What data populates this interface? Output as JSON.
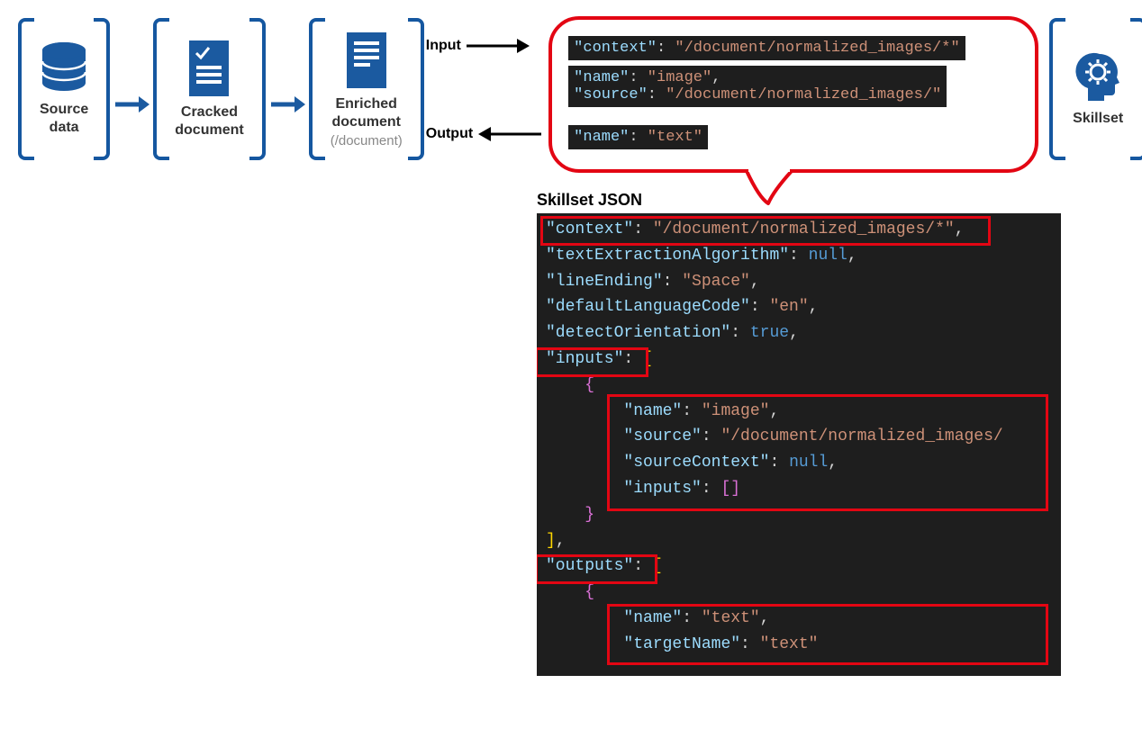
{
  "stages": {
    "source": {
      "label": "Source\ndata"
    },
    "cracked": {
      "label": "Cracked\ndocument"
    },
    "enriched": {
      "label": "Enriched\ndocument",
      "sublabel": "(/document)"
    },
    "skillset": {
      "label": "Skillset"
    }
  },
  "io": {
    "input": "Input",
    "output": "Output"
  },
  "bubble": {
    "context_key": "\"context\"",
    "context_val": "\"/document/normalized_images/*\"",
    "name_key": "\"name\"",
    "name_val_image": "\"image\"",
    "source_key": "\"source\"",
    "source_val": "\"/document/normalized_images/\"",
    "name_val_text": "\"text\""
  },
  "jsonPanel": {
    "title": "Skillset JSON",
    "lines": {
      "l1a": "\"context\"",
      "l1b": "\"/document/normalized_images/*\"",
      "l2a": "\"textExtractionAlgorithm\"",
      "l2b": "null",
      "l3a": "\"lineEnding\"",
      "l3b": "\"Space\"",
      "l4a": "\"defaultLanguageCode\"",
      "l4b": "\"en\"",
      "l5a": "\"detectOrientation\"",
      "l5b": "true",
      "l6a": "\"inputs\"",
      "l8a": "\"name\"",
      "l8b": "\"image\"",
      "l9a": "\"source\"",
      "l9b": "\"/document/normalized_images/",
      "l10a": "\"sourceContext\"",
      "l10b": "null",
      "l11a": "\"inputs\"",
      "l14a": "\"outputs\"",
      "l16a": "\"name\"",
      "l16b": "\"text\"",
      "l17a": "\"targetName\"",
      "l17b": "\"text\""
    }
  }
}
